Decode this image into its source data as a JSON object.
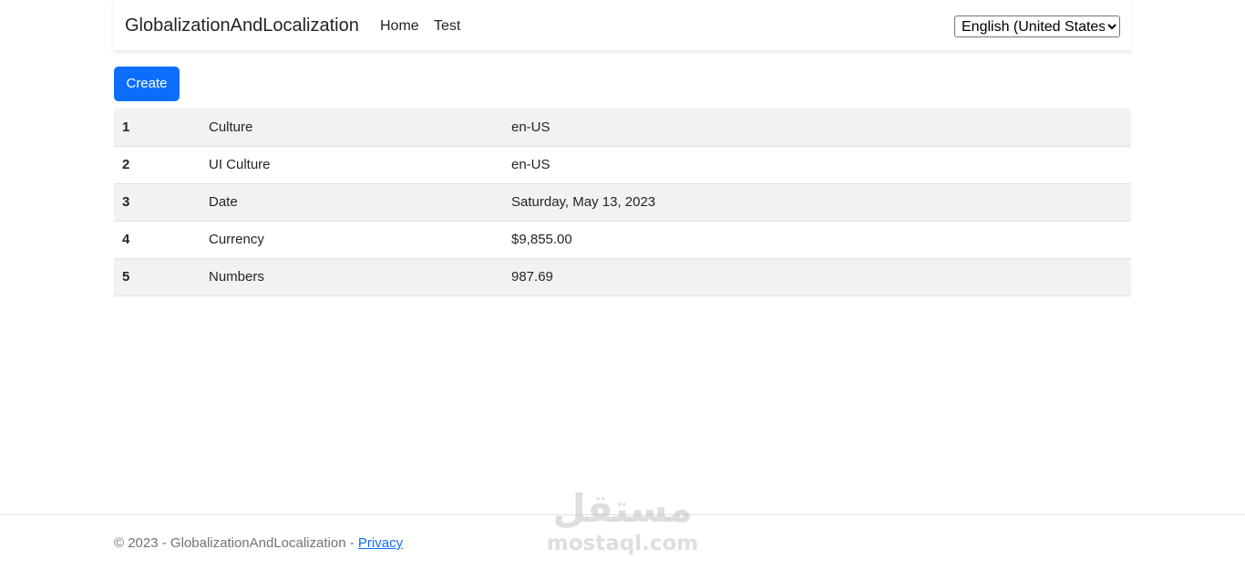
{
  "navbar": {
    "brand": "GlobalizationAndLocalization",
    "links": [
      {
        "label": "Home"
      },
      {
        "label": "Test"
      }
    ],
    "language_select": {
      "selected": "English (United States)"
    }
  },
  "actions": {
    "create_label": "Create"
  },
  "table": {
    "rows": [
      {
        "num": "1",
        "label": "Culture",
        "value": "en-US"
      },
      {
        "num": "2",
        "label": "UI Culture",
        "value": "en-US"
      },
      {
        "num": "3",
        "label": "Date",
        "value": "Saturday, May 13, 2023"
      },
      {
        "num": "4",
        "label": "Currency",
        "value": "$9,855.00"
      },
      {
        "num": "5",
        "label": "Numbers",
        "value": "987.69"
      }
    ]
  },
  "footer": {
    "text": "© 2023 - GlobalizationAndLocalization - ",
    "privacy_label": "Privacy"
  },
  "watermark": {
    "arabic": "مستقل",
    "latin": "mostaql.com"
  },
  "colors": {
    "primary": "#0d6efd",
    "striped_row": "#f2f2f2",
    "footer_text": "#6c757d"
  }
}
